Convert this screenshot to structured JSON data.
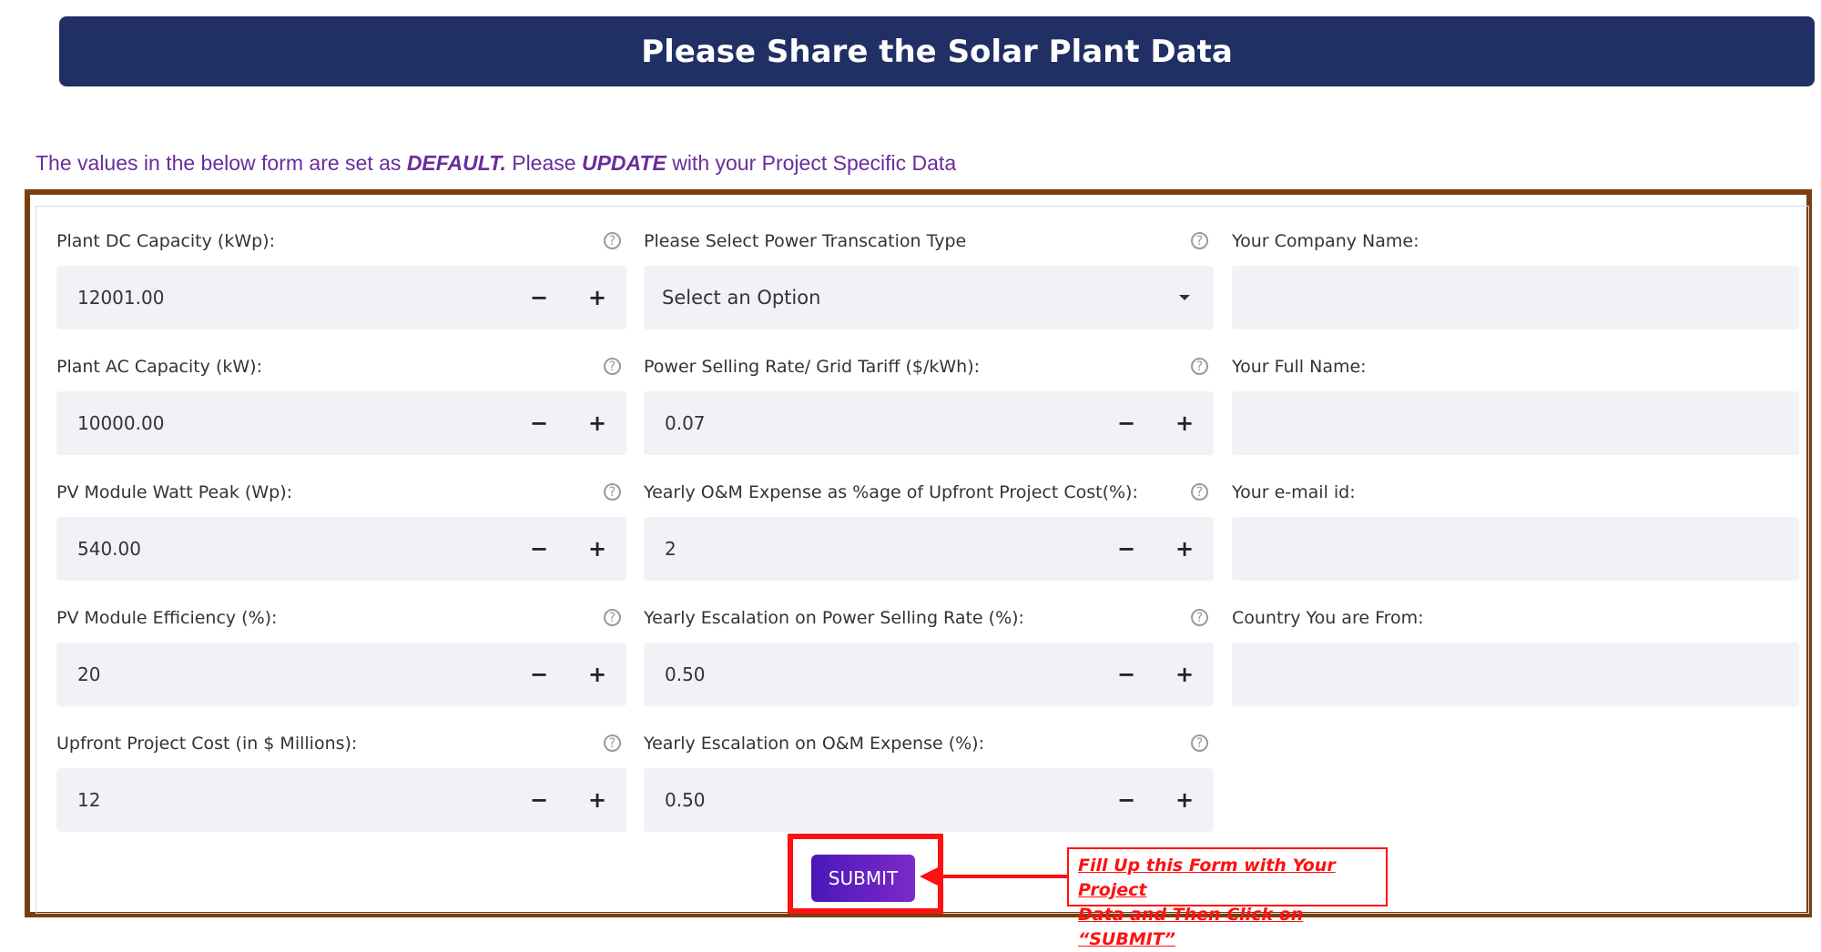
{
  "header": {
    "title": "Please Share the Solar Plant Data"
  },
  "subtitle": {
    "part1": "The values in the below form are set as ",
    "default_word": "DEFAULT.",
    "part2": " Please ",
    "update_word": "UPDATE",
    "part3": " with your Project Specific Data"
  },
  "fields": {
    "dc_capacity": {
      "label": "Plant DC Capacity (kWp):",
      "value": "12001.00"
    },
    "ac_capacity": {
      "label": "Plant AC Capacity (kW):",
      "value": "10000.00"
    },
    "module_watt": {
      "label": "PV Module Watt Peak (Wp):",
      "value": "540.00"
    },
    "module_eff": {
      "label": "PV Module Efficiency (%):",
      "value": "20"
    },
    "upfront_cost": {
      "label": "Upfront Project Cost (in $ Millions):",
      "value": "12"
    },
    "transaction_type": {
      "label": "Please Select Power Transcation Type",
      "value": "Select an Option"
    },
    "selling_rate": {
      "label": "Power Selling Rate/ Grid Tariff ($/kWh):",
      "value": "0.07"
    },
    "om_expense": {
      "label": "Yearly O&M Expense as %age of Upfront Project Cost(%):",
      "value": "2"
    },
    "esc_selling": {
      "label": "Yearly Escalation on Power Selling Rate (%):",
      "value": "0.50"
    },
    "esc_om": {
      "label": "Yearly Escalation on O&M Expense (%):",
      "value": "0.50"
    },
    "company": {
      "label": "Your Company Name:",
      "value": ""
    },
    "full_name": {
      "label": "Your Full Name:",
      "value": ""
    },
    "email": {
      "label": "Your e-mail id:",
      "value": ""
    },
    "country": {
      "label": "Country You are From:",
      "value": ""
    }
  },
  "controls": {
    "minus": "−",
    "plus": "+",
    "help": "?"
  },
  "submit": {
    "label": "SUBMIT"
  },
  "callout": {
    "line1": "Fill Up this Form with Your Project",
    "line2": "Data and Then Click on “SUBMIT”"
  },
  "colors": {
    "banner": "#203064",
    "frame": "#7a3e10",
    "accent_red": "#ff1111",
    "subtitle": "#6a2c9c",
    "button": "#5a1fc0"
  }
}
